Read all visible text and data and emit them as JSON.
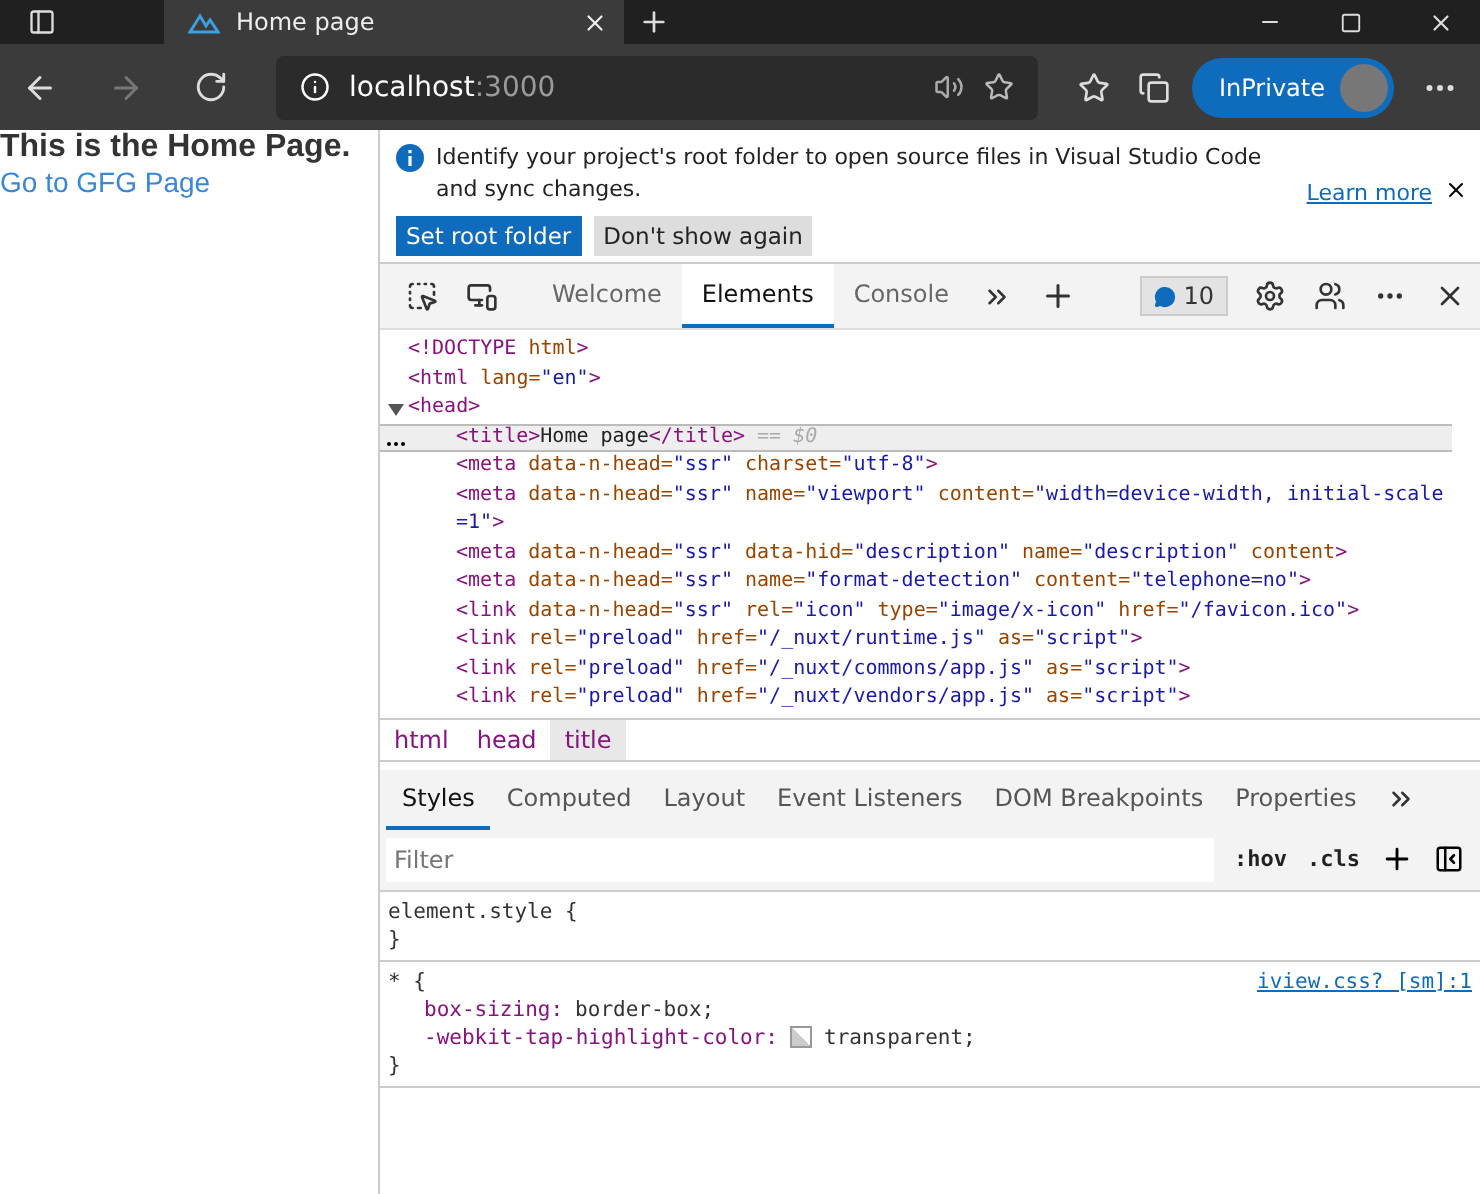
{
  "browser": {
    "tab_title": "Home page",
    "address_host": "localhost",
    "address_port": ":3000",
    "inprivate": "InPrivate"
  },
  "page": {
    "heading": "This is the Home Page.",
    "link": "Go to GFG Page"
  },
  "infobar": {
    "message": "Identify your project's root folder to open source files in Visual Studio Code and sync changes.",
    "learn_more": "Learn more",
    "buttons": [
      {
        "label": "Set root folder",
        "primary": true
      },
      {
        "label": "Don't show again",
        "primary": false
      }
    ]
  },
  "devtools_tabs": [
    {
      "label": "Welcome",
      "selected": false
    },
    {
      "label": "Elements",
      "selected": true
    },
    {
      "label": "Console",
      "selected": false
    }
  ],
  "issues_count": "10",
  "dom": [
    {
      "text": "<!DOCTYPE html>",
      "selected": false
    },
    {
      "text": "<html lang=\"en\">",
      "selected": false
    },
    {
      "text": "<head>",
      "selected": false,
      "expanded": true,
      "children": [
        {
          "text": "<title>Home page</title>",
          "note": "== $0",
          "selected": true
        },
        {
          "text": "<meta data-n-head=\"ssr\" charset=\"utf-8\">",
          "selected": false
        },
        {
          "text": "<meta data-n-head=\"ssr\" name=\"viewport\" content=\"width=device-width, initial-scale=1\">",
          "selected": false
        },
        {
          "text": "<meta data-n-head=\"ssr\" data-hid=\"description\" name=\"description\" content>",
          "selected": false
        },
        {
          "text": "<meta data-n-head=\"ssr\" name=\"format-detection\" content=\"telephone=no\">",
          "selected": false
        },
        {
          "text": "<link data-n-head=\"ssr\" rel=\"icon\" type=\"image/x-icon\" href=\"/favicon.ico\">",
          "selected": false
        },
        {
          "text": "<link rel=\"preload\" href=\"/_nuxt/runtime.js\" as=\"script\">",
          "selected": false
        },
        {
          "text": "<link rel=\"preload\" href=\"/_nuxt/commons/app.js\" as=\"script\">",
          "selected": false
        },
        {
          "text": "<link rel=\"preload\" href=\"/_nuxt/vendors/app.js\" as=\"script\">",
          "selected": false
        }
      ]
    }
  ],
  "breadcrumbs": [
    {
      "label": "html",
      "selected": false
    },
    {
      "label": "head",
      "selected": false
    },
    {
      "label": "title",
      "selected": true
    }
  ],
  "styles_tabs": [
    {
      "label": "Styles",
      "selected": true
    },
    {
      "label": "Computed",
      "selected": false
    },
    {
      "label": "Layout",
      "selected": false
    },
    {
      "label": "Event Listeners",
      "selected": false
    },
    {
      "label": "DOM Breakpoints",
      "selected": false
    },
    {
      "label": "Properties",
      "selected": false
    }
  ],
  "filter": {
    "placeholder": "Filter"
  },
  "hov": ":hov",
  "cls": ".cls",
  "rules": [
    {
      "selector": "element.style {",
      "close": "}"
    },
    {
      "selector": "* {",
      "source": "iview.css? [sm]:1",
      "declarations": [
        {
          "property": "box-sizing:",
          "value": "border-box;",
          "swatch": false
        },
        {
          "property": "-webkit-tap-highlight-color:",
          "value": "transparent;",
          "swatch": true
        }
      ],
      "close": "}"
    }
  ]
}
